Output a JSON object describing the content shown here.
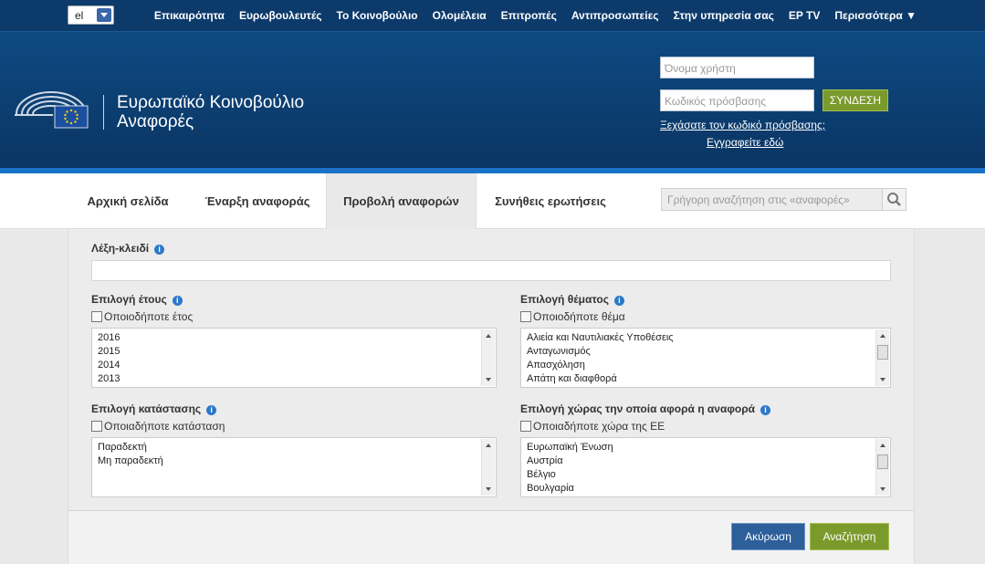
{
  "lang": {
    "value": "el"
  },
  "topnav": [
    "Επικαιρότητα",
    "Ευρωβουλευτές",
    "Το Κοινοβούλιο",
    "Ολομέλεια",
    "Επιτροπές",
    "Αντιπροσωπείες",
    "Στην υπηρεσία σας",
    "EP TV",
    "Περισσότερα ▼"
  ],
  "header": {
    "title_line1": "Ευρωπαϊκό Κοινοβούλιο",
    "title_line2": "Αναφορές",
    "username_placeholder": "Όνομα χρήστη",
    "password_placeholder": "Κωδικός πρόσβασης",
    "login_label": "ΣΥΝΔΕΣΗ",
    "forgot_link": "Ξεχάσατε τον κωδικό πρόσβασης;",
    "register_link": "Εγγραφείτε εδώ"
  },
  "tabs": [
    "Αρχική σελίδα",
    "Έναρξη αναφοράς",
    "Προβολή αναφορών",
    "Συνήθεις ερωτήσεις"
  ],
  "quick_search_placeholder": "Γρήγορη αναζήτηση στις «αναφορές»",
  "form": {
    "keyword_label": "Λέξη-κλειδί",
    "year_label": "Επιλογή έτους",
    "year_any": "Οποιοδήποτε έτος",
    "years": [
      "2016",
      "2015",
      "2014",
      "2013"
    ],
    "topic_label": "Επιλογή θέματος",
    "topic_any": "Οποιοδήποτε θέμα",
    "topics": [
      "Αλιεία και Ναυτιλιακές Υποθέσεις",
      "Ανταγωνισμός",
      "Απασχόληση",
      "Απάτη και διαφθορά"
    ],
    "status_label": "Επιλογή κατάστασης",
    "status_any": "Οποιαδήποτε κατάσταση",
    "statuses": [
      "Παραδεκτή",
      "Μη παραδεκτή"
    ],
    "country_label": "Επιλογή χώρας την οποία αφορά η αναφορά",
    "country_any": "Οποιαδήποτε χώρα της ΕΕ",
    "countries": [
      "Ευρωπαϊκή Ένωση",
      "Αυστρία",
      "Βέλγιο",
      "Βουλγαρία"
    ],
    "cancel_label": "Ακύρωση",
    "search_label": "Αναζήτηση"
  }
}
